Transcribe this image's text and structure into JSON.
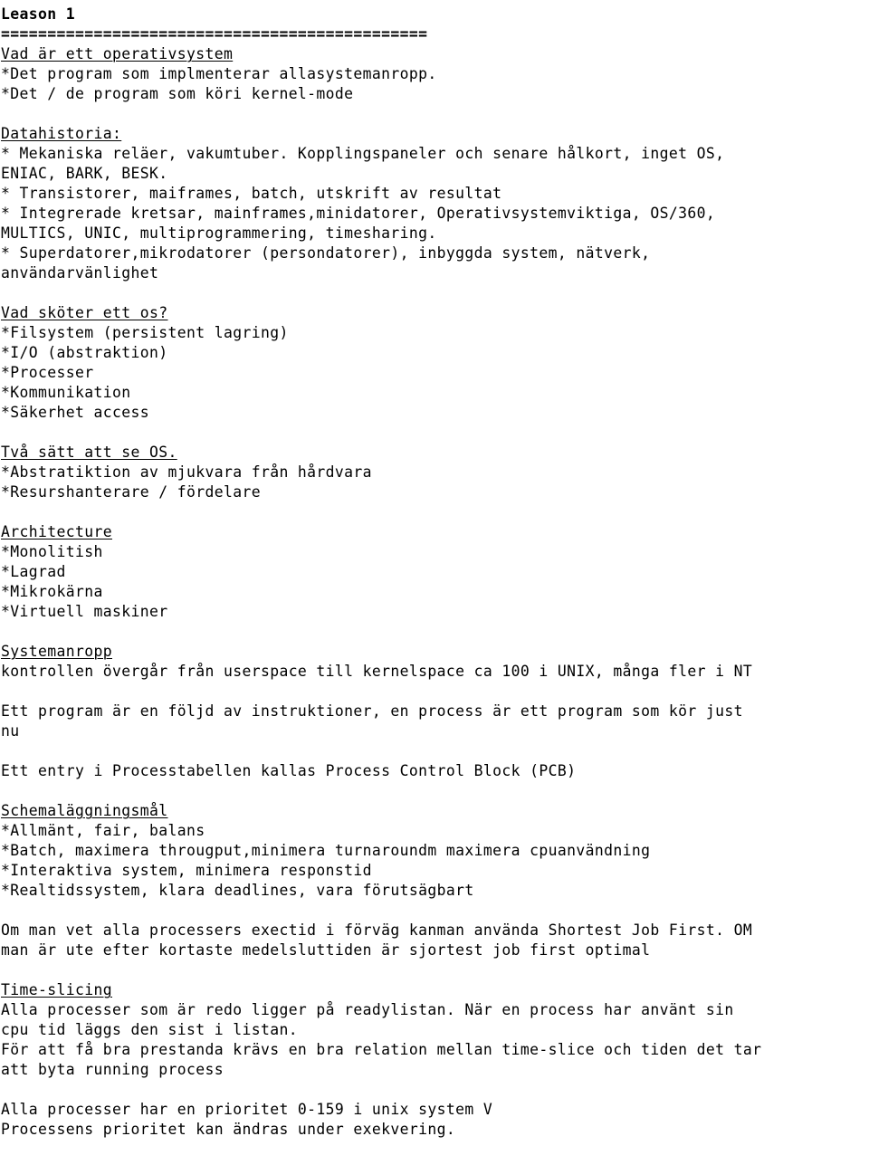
{
  "document": {
    "title": "Leason 1",
    "background_color": "#ffffff",
    "text_color": "#000000",
    "lines": [
      {
        "id": "title",
        "kind": "title",
        "text": "Leason 1"
      },
      {
        "id": "rule-1",
        "kind": "rule",
        "text": "=============================================="
      },
      {
        "id": "head-1",
        "kind": "heading",
        "text": "Vad är ett operativsystem"
      },
      {
        "id": "body-1",
        "kind": "body",
        "text": "*Det program som implmenterar allasystemanropp."
      },
      {
        "id": "body-2",
        "kind": "body",
        "text": "*Det / de program som köri kernel-mode"
      },
      {
        "id": "blank-1",
        "kind": "blank",
        "text": ""
      },
      {
        "id": "head-2",
        "kind": "heading",
        "text": "Datahistoria:"
      },
      {
        "id": "body-3",
        "kind": "body",
        "text": "* Mekaniska reläer, vakumtuber. Kopplingspaneler och senare hålkort, inget OS,"
      },
      {
        "id": "body-4",
        "kind": "body",
        "text": "ENIAC, BARK, BESK."
      },
      {
        "id": "body-5",
        "kind": "body",
        "text": "* Transistorer, maiframes, batch, utskrift av resultat"
      },
      {
        "id": "body-6",
        "kind": "body",
        "text": "* Integrerade kretsar, mainframes,minidatorer, Operativsystemviktiga, OS/360,"
      },
      {
        "id": "body-7",
        "kind": "body",
        "text": "MULTICS, UNIC, multiprogrammering, timesharing."
      },
      {
        "id": "body-8",
        "kind": "body",
        "text": "* Superdatorer,mikrodatorer (persondatorer), inbyggda system, nätverk,"
      },
      {
        "id": "body-9",
        "kind": "body",
        "text": "användarvänlighet"
      },
      {
        "id": "blank-2",
        "kind": "blank",
        "text": ""
      },
      {
        "id": "head-3",
        "kind": "heading",
        "text": "Vad sköter ett os?"
      },
      {
        "id": "body-10",
        "kind": "body",
        "text": "*Filsystem (persistent lagring)"
      },
      {
        "id": "body-11",
        "kind": "body",
        "text": "*I/O (abstraktion)"
      },
      {
        "id": "body-12",
        "kind": "body",
        "text": "*Processer"
      },
      {
        "id": "body-13",
        "kind": "body",
        "text": "*Kommunikation"
      },
      {
        "id": "body-14",
        "kind": "body",
        "text": "*Säkerhet access"
      },
      {
        "id": "blank-3",
        "kind": "blank",
        "text": ""
      },
      {
        "id": "head-4",
        "kind": "heading",
        "text": "Två sätt att se OS."
      },
      {
        "id": "body-15",
        "kind": "body",
        "text": "*Abstratiktion av mjukvara från hårdvara"
      },
      {
        "id": "body-16",
        "kind": "body",
        "text": "*Resurshanterare / fördelare"
      },
      {
        "id": "blank-4",
        "kind": "blank",
        "text": ""
      },
      {
        "id": "head-5",
        "kind": "heading",
        "text": "Architecture"
      },
      {
        "id": "body-17",
        "kind": "body",
        "text": "*Monolitish"
      },
      {
        "id": "body-18",
        "kind": "body",
        "text": "*Lagrad"
      },
      {
        "id": "body-19",
        "kind": "body",
        "text": "*Mikrokärna"
      },
      {
        "id": "body-20",
        "kind": "body",
        "text": "*Virtuell maskiner"
      },
      {
        "id": "blank-5",
        "kind": "blank",
        "text": ""
      },
      {
        "id": "head-6",
        "kind": "heading",
        "text": "Systemanropp"
      },
      {
        "id": "body-21",
        "kind": "body",
        "text": "kontrollen övergår från userspace till kernelspace ca 100 i UNIX, många fler i NT"
      },
      {
        "id": "blank-6",
        "kind": "blank",
        "text": ""
      },
      {
        "id": "body-22",
        "kind": "body",
        "text": "Ett program är en följd av instruktioner, en process är ett program som kör just"
      },
      {
        "id": "body-23",
        "kind": "body",
        "text": "nu"
      },
      {
        "id": "blank-7",
        "kind": "blank",
        "text": ""
      },
      {
        "id": "body-24",
        "kind": "body",
        "text": "Ett entry i Processtabellen kallas Process Control Block (PCB)"
      },
      {
        "id": "blank-8",
        "kind": "blank",
        "text": ""
      },
      {
        "id": "head-7",
        "kind": "heading",
        "text": "Schemaläggningsmål"
      },
      {
        "id": "body-25",
        "kind": "body",
        "text": "*Allmänt, fair, balans"
      },
      {
        "id": "body-26",
        "kind": "body",
        "text": "*Batch, maximera througput,minimera turnaroundm maximera cpuanvändning"
      },
      {
        "id": "body-27",
        "kind": "body",
        "text": "*Interaktiva system, minimera responstid"
      },
      {
        "id": "body-28",
        "kind": "body",
        "text": "*Realtidssystem, klara deadlines, vara förutsägbart"
      },
      {
        "id": "blank-9",
        "kind": "blank",
        "text": ""
      },
      {
        "id": "body-29",
        "kind": "body",
        "text": "Om man vet alla processers exectid i förväg kanman använda Shortest Job First. OM"
      },
      {
        "id": "body-30",
        "kind": "body",
        "text": "man är ute efter kortaste medelsluttiden är sjortest job first optimal"
      },
      {
        "id": "blank-10",
        "kind": "blank",
        "text": ""
      },
      {
        "id": "head-8",
        "kind": "heading",
        "text": "Time-slicing"
      },
      {
        "id": "body-31",
        "kind": "body",
        "text": "Alla processer som är redo ligger på readylistan. När en process har använt sin"
      },
      {
        "id": "body-32",
        "kind": "body",
        "text": "cpu tid läggs den sist i listan."
      },
      {
        "id": "body-33",
        "kind": "body",
        "text": "För att få bra prestanda krävs en bra relation mellan time-slice och tiden det tar"
      },
      {
        "id": "body-34",
        "kind": "body",
        "text": "att byta running process"
      },
      {
        "id": "blank-11",
        "kind": "blank",
        "text": ""
      },
      {
        "id": "body-35",
        "kind": "body",
        "text": "Alla processer har en prioritet 0-159 i unix system V"
      },
      {
        "id": "body-36",
        "kind": "body",
        "text": "Processens prioritet kan ändras under exekvering."
      }
    ]
  }
}
